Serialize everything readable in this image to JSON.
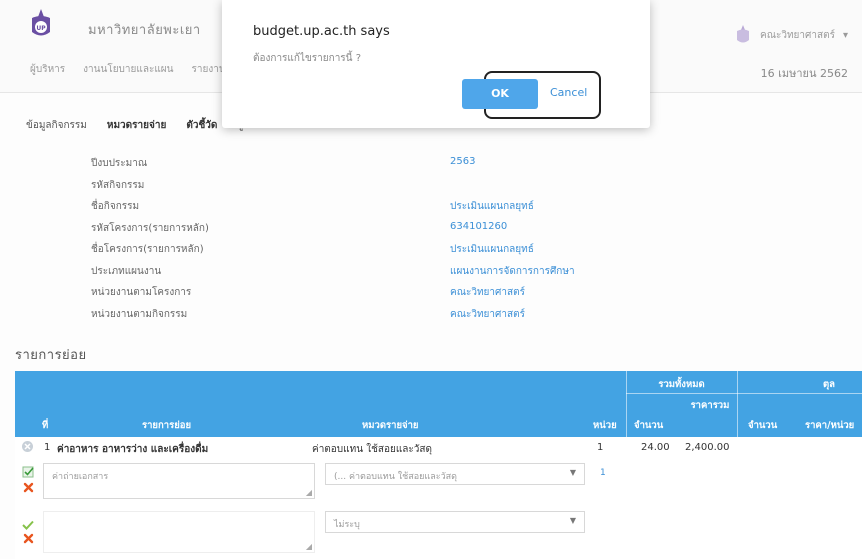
{
  "header": {
    "site_title": "มหาวิทยาลัยพะเยา",
    "logo_text": "UP",
    "user": "คณะวิทยาศาสตร์",
    "user_caret": "▾",
    "date": "16 เมษายน 2562",
    "menu": [
      "ผู้บริหาร",
      "งานนโยบายและแผน",
      "รายงานโครงการ"
    ]
  },
  "tabs": [
    "ข้อมูลกิจกรรม",
    "หมวดรายจ่าย",
    "ตัวชี้วัด",
    "ผู้รับผิดชอบ"
  ],
  "info": [
    {
      "label": "ปีงบประมาณ",
      "value": "2563"
    },
    {
      "label": "รหัสกิจกรรม",
      "value": ""
    },
    {
      "label": "ชื่อกิจกรรม",
      "value": "ประเมินแผนกลยุทธ์"
    },
    {
      "label": "รหัสโครงการ(รายการหลัก)",
      "value": "634101260"
    },
    {
      "label": "ชื่อโครงการ(รายการหลัก)",
      "value": "ประเมินแผนกลยุทธ์"
    },
    {
      "label": "ประเภทแผนงาน",
      "value": "แผนงานการจัดการการศึกษา"
    },
    {
      "label": "หน่วยงานตามโครงการ",
      "value": "คณะวิทยาศาสตร์"
    },
    {
      "label": "หน่วยงานตามกิจกรรม",
      "value": "คณะวิทยาศาสตร์"
    }
  ],
  "section_title": "รายการย่อย",
  "grid": {
    "headers": {
      "no": "ที่",
      "item": "รายการย่อย",
      "category": "หมวดรายจ่าย",
      "unit": "หน่วย",
      "group_total": "รวมทั้งหมด",
      "qty": "จำนวน",
      "total_price": "ราคารวม",
      "group_right": "ตุล",
      "qty2": "จำนวน",
      "unit_price": "ราคา/หน่วย"
    },
    "row": {
      "no": "1",
      "item": "ค่าอาหาร อาหารว่าง และเครื่องดื่ม",
      "category": "ค่าตอบแทน ใช้สอยและวัสดุ",
      "unit": "1",
      "qty": "24.00",
      "total": "2,400.00"
    },
    "edit_row": {
      "text": "ค่าถ่ายเอกสาร",
      "select": "(... ค่าตอบแทน ใช้สอยและวัสดุ",
      "unit": "1"
    },
    "new_row": {
      "text": "",
      "select": "ไม่ระบุ"
    }
  },
  "dialog": {
    "title": "budget.up.ac.th says",
    "message": "ต้องการแก้ไขรายการนี้ ?",
    "ok": "OK",
    "cancel": "Cancel"
  },
  "colors": {
    "header_blue": "#43a3e3",
    "link_blue": "#3b8fd6",
    "ok_blue": "#4fa6ea",
    "logo_purple": "#6a4fa3"
  }
}
